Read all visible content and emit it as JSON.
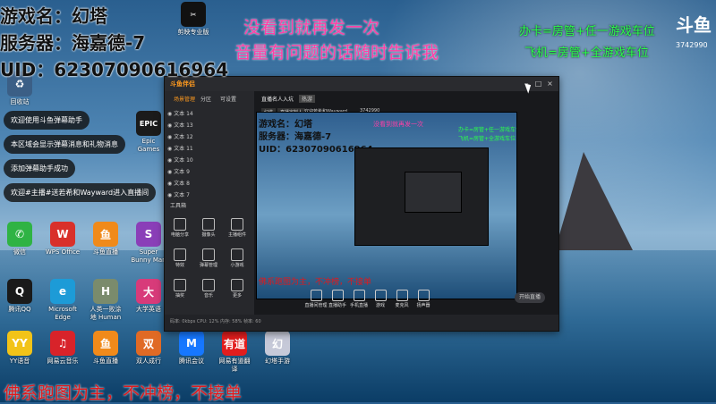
{
  "overlay": {
    "game_line": "游戏名：幻塔",
    "server_line": "服务器：海嘉德-7",
    "uid_line": "UID：62307090616964",
    "pink_line1": "没看到就再发一次",
    "pink_line2": "音量有问题的话随时告诉我",
    "green_line1": "办卡=房管+任一游戏车位",
    "green_line2": "飞机=房管+全游戏车位",
    "red_footer": "佛系跑图为主，不冲榜，不接单",
    "logo": "斗鱼",
    "room_number": "3742990"
  },
  "desktop_icons": [
    {
      "label": "回收站",
      "color": "#3b5f86",
      "glyph": "♻"
    },
    {
      "label": "微信",
      "color": "#2fb344",
      "glyph": "✆"
    },
    {
      "label": "WPS Office",
      "color": "#d9302a",
      "glyph": "W"
    },
    {
      "label": "斗鱼直播",
      "color": "#f08a1a",
      "glyph": "鱼"
    },
    {
      "label": "Super Bunny Man",
      "color": "#8a3fb8",
      "glyph": "S"
    },
    {
      "label": "腾讯QQ",
      "color": "#1a1a1a",
      "glyph": "Q"
    },
    {
      "label": "Microsoft Edge",
      "color": "#1d9bd7",
      "glyph": "e"
    },
    {
      "label": "人类一败涂地 Human Fa...",
      "color": "#7a8b6c",
      "glyph": "H"
    },
    {
      "label": "大学英语",
      "color": "#d83b7a",
      "glyph": "大"
    },
    {
      "label": "YY语音",
      "color": "#f2c318",
      "glyph": "YY"
    },
    {
      "label": "网易云音乐",
      "color": "#d8232a",
      "glyph": "♫"
    },
    {
      "label": "斗鱼直播",
      "color": "#f08a1a",
      "glyph": "鱼"
    },
    {
      "label": "双人成行",
      "color": "#e06a25",
      "glyph": "双"
    },
    {
      "label": "腾讯会议",
      "color": "#1677ff",
      "glyph": "M"
    },
    {
      "label": "网易有道翻译",
      "color": "#e21d1d",
      "glyph": "有道"
    },
    {
      "label": "幻塔手游",
      "color": "#c6c9d8",
      "glyph": "幻"
    }
  ],
  "top_icons": [
    {
      "label": "Epic Games Launcher",
      "color": "#1b1b1b",
      "glyph": "EPIC"
    },
    {
      "label": "剪映专业版",
      "color": "#111",
      "glyph": "✂"
    }
  ],
  "helper_messages": [
    "欢迎使用斗鱼弹幕助手",
    "本区域会显示弹幕消息和礼物消息",
    "添加弹幕助手成功",
    "欢迎#主播#送若希和Wayward进入直播间"
  ],
  "app": {
    "brand": "斗鱼伴侣",
    "left_tabs": [
      "场景管理",
      "分区",
      "可设置"
    ],
    "scenes": [
      "文本 14",
      "文本 13",
      "文本 12",
      "文本 11",
      "文本 10",
      "文本 9",
      "文本 8",
      "文本 7"
    ],
    "left_section": "工具箱",
    "tools": [
      "电脑分享",
      "摄像头",
      "主播组件",
      "特效",
      "弹幕管理",
      "小游戏",
      "抽奖",
      "音乐",
      "更多"
    ],
    "mid_tabs": [
      "直播名人入坑",
      "热游"
    ],
    "mid_chips": [
      "幻塔",
      "直播定制人",
      "欢迎若希和Wayward",
      "3742990"
    ],
    "bottom_tools": [
      "直播间管理",
      "直播助手",
      "手机直播",
      "游戏",
      "麦克风",
      "扬声器"
    ],
    "start_button": "开始直播",
    "status_text": "码率: 0kbps  CPU: 12%  内存: 58%  帧率: 60"
  }
}
